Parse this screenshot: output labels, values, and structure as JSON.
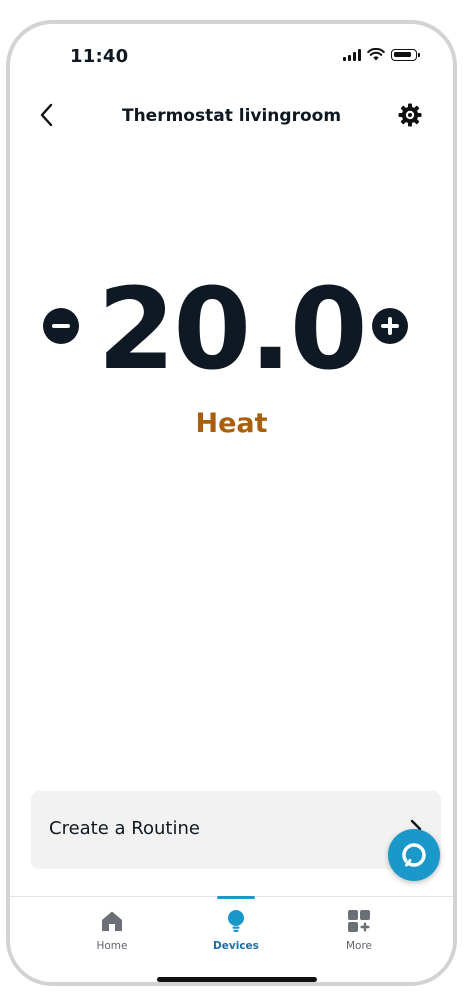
{
  "status": {
    "time": "11:40"
  },
  "header": {
    "title": "Thermostat livingroom"
  },
  "thermostat": {
    "temperature": "20.0",
    "mode": "Heat"
  },
  "routine": {
    "label": "Create a Routine"
  },
  "nav": {
    "items": [
      {
        "label": "Home",
        "icon": "home-icon"
      },
      {
        "label": "Devices",
        "icon": "lightbulb-icon",
        "active": true
      },
      {
        "label": "More",
        "icon": "grid-plus-icon"
      }
    ]
  },
  "colors": {
    "text": "#0f1923",
    "mode": "#a8600e",
    "accent": "#1a98c9",
    "card": "#f2f2f2"
  }
}
